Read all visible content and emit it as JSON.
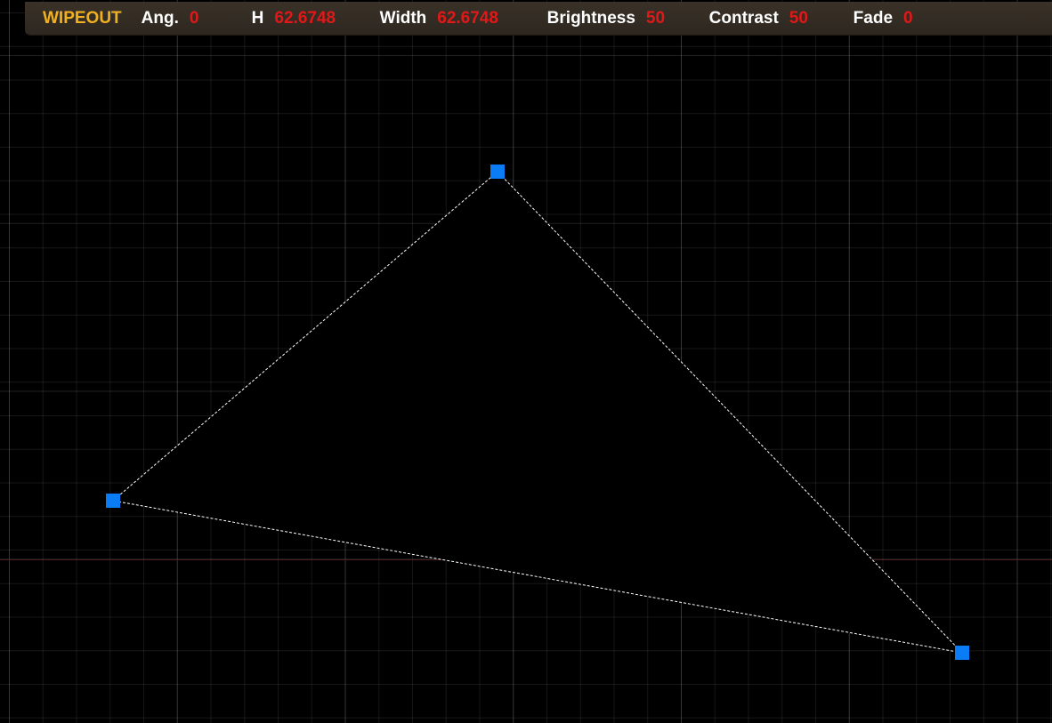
{
  "toolbar": {
    "command": "WIPEOUT",
    "fields": [
      {
        "label": "Ang.",
        "value": "0"
      },
      {
        "label": "H",
        "value": "62.6748"
      },
      {
        "label": "Width",
        "value": "62.6748"
      },
      {
        "label": "Brightness",
        "value": "50"
      },
      {
        "label": "Contrast",
        "value": "50"
      },
      {
        "label": "Fade",
        "value": "0"
      }
    ]
  },
  "colors": {
    "background": "#000000",
    "command_label": "#f0b020",
    "field_label": "#ffffff",
    "field_value": "#e01818",
    "grip": "#0a7cf5",
    "boundary": "#ffffff"
  },
  "wipeout": {
    "shape": "triangle",
    "grips": [
      "grip-top",
      "grip-left",
      "grip-right"
    ]
  }
}
